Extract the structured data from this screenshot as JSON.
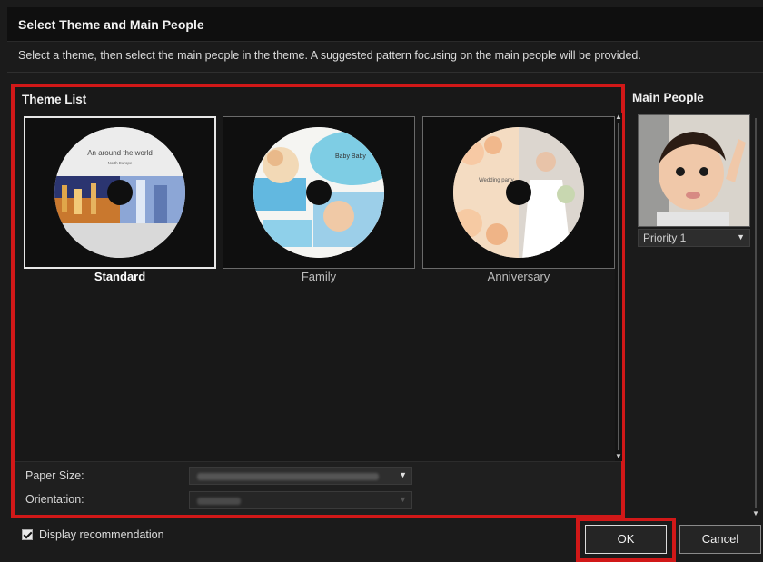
{
  "dialog": {
    "title": "Select Theme and Main People",
    "instruction": "Select a theme, then select the main people in the theme. A suggested pattern focusing on the main people will be provided."
  },
  "theme_list": {
    "heading": "Theme List",
    "selected": "Standard",
    "themes": [
      {
        "label": "Standard",
        "disc_text_1": "An around the world",
        "disc_text_2": "North Europe"
      },
      {
        "label": "Family",
        "disc_text_1": "Baby Baby",
        "disc_text_2": ""
      },
      {
        "label": "Anniversary",
        "disc_text_1": "Wedding party",
        "disc_text_2": ""
      }
    ]
  },
  "settings": {
    "paper_size_label": "Paper Size:",
    "orientation_label": "Orientation:"
  },
  "main_people": {
    "heading": "Main People",
    "priority_value": "Priority 1"
  },
  "footer": {
    "display_recommendation_label": "Display recommendation",
    "display_recommendation_checked": true,
    "ok_label": "OK",
    "cancel_label": "Cancel"
  },
  "colors": {
    "highlight": "#d11818",
    "background": "#1b1b1b"
  }
}
